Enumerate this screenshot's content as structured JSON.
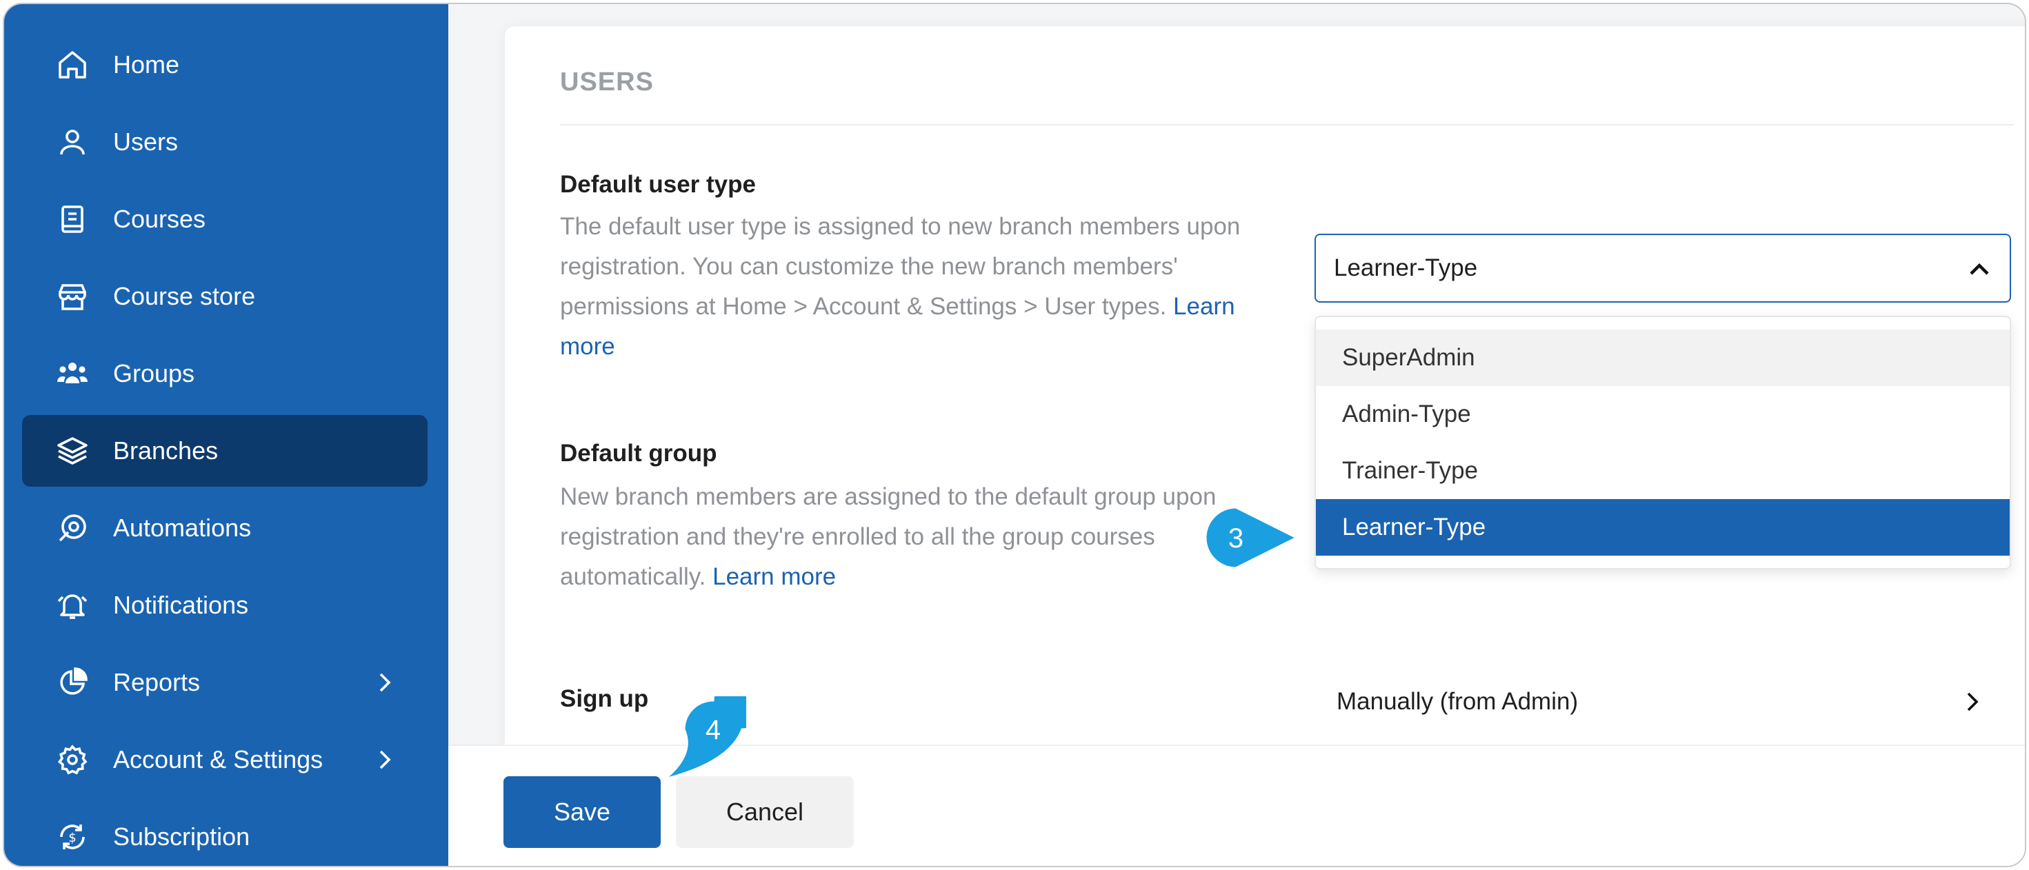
{
  "sidebar": {
    "items": [
      {
        "label": "Home",
        "icon": "home-icon"
      },
      {
        "label": "Users",
        "icon": "user-icon"
      },
      {
        "label": "Courses",
        "icon": "book-icon"
      },
      {
        "label": "Course store",
        "icon": "store-icon"
      },
      {
        "label": "Groups",
        "icon": "groups-icon"
      },
      {
        "label": "Branches",
        "icon": "layers-icon",
        "active": true
      },
      {
        "label": "Automations",
        "icon": "automation-icon"
      },
      {
        "label": "Notifications",
        "icon": "bell-icon"
      },
      {
        "label": "Reports",
        "icon": "pie-chart-icon",
        "has_submenu": true
      },
      {
        "label": "Account & Settings",
        "icon": "gear-icon",
        "has_submenu": true
      },
      {
        "label": "Subscription",
        "icon": "subscription-icon"
      }
    ]
  },
  "main": {
    "section_title": "USERS",
    "default_user_type": {
      "title": "Default user type",
      "description": "The default user type is assigned to new branch members upon registration. You can customize the new branch members' permissions at Home > Account & Settings > User types.",
      "learn_more": "Learn more",
      "selected_value": "Learner-Type",
      "options": [
        "SuperAdmin",
        "Admin-Type",
        "Trainer-Type",
        "Learner-Type"
      ]
    },
    "default_group": {
      "title": "Default group",
      "description": "New branch members are assigned to the default group upon registration and they're enrolled to all the group courses automatically.",
      "learn_more": "Learn more"
    },
    "sign_up": {
      "title": "Sign up",
      "value": "Manually (from Admin)"
    }
  },
  "footer": {
    "save_label": "Save",
    "cancel_label": "Cancel"
  },
  "callouts": {
    "step3": "3",
    "step4": "4"
  },
  "colors": {
    "sidebar_bg": "#1a63b0",
    "sidebar_active": "#0d3a6c",
    "accent": "#1a63b0",
    "callout": "#1a9fe0"
  }
}
